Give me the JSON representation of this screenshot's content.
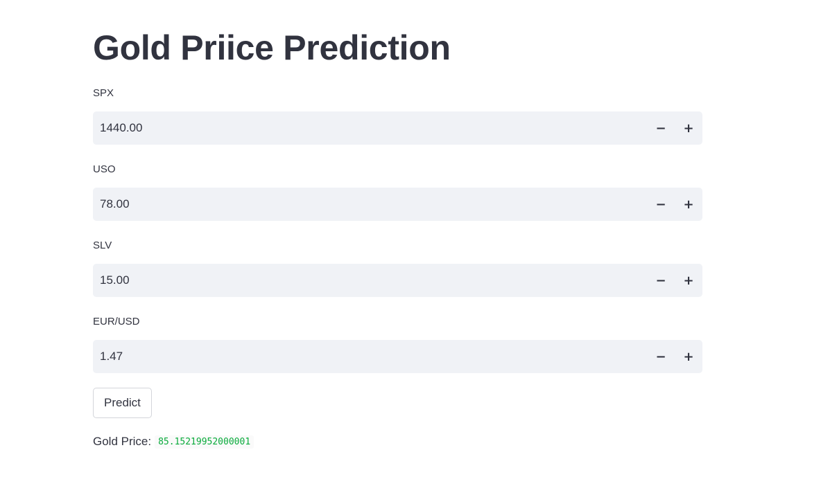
{
  "page": {
    "title": "Gold Priice Prediction"
  },
  "fields": [
    {
      "label": "SPX",
      "value": "1440.00"
    },
    {
      "label": "USO",
      "value": "78.00"
    },
    {
      "label": "SLV",
      "value": "15.00"
    },
    {
      "label": "EUR/USD",
      "value": "1.47"
    }
  ],
  "stepper": {
    "minus": "−",
    "plus": "+"
  },
  "predict_button": {
    "label": "Predict"
  },
  "result": {
    "label": "Gold Price:",
    "value": "85.15219952000001"
  },
  "colors": {
    "text": "#31333f",
    "input_background": "#f0f2f6",
    "result_value": "#09ab3b"
  }
}
